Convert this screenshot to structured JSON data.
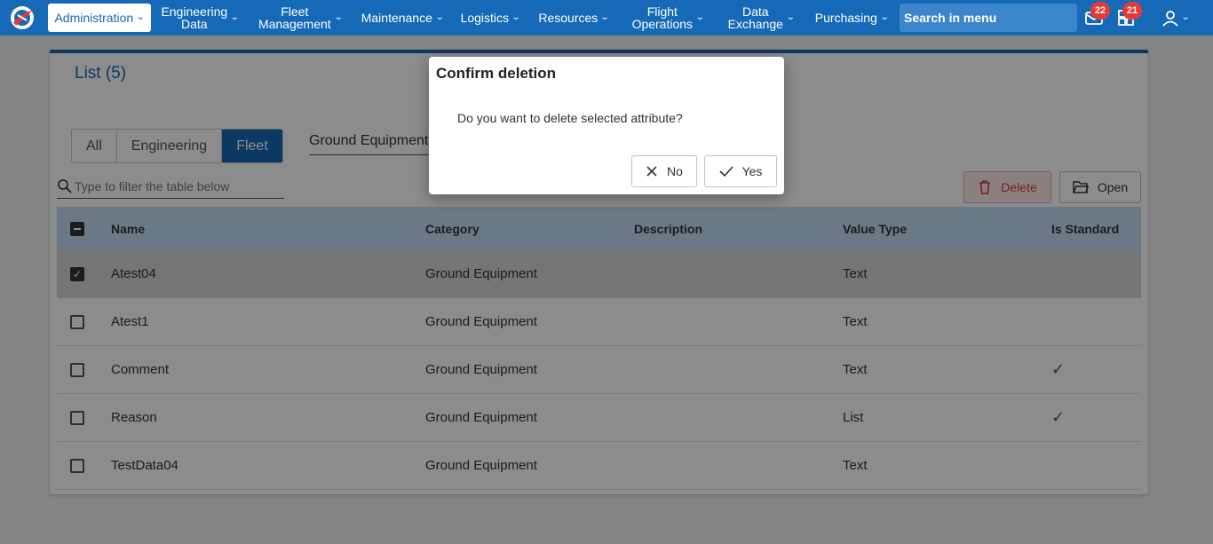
{
  "nav": {
    "items": [
      {
        "label": "Administration",
        "active": true
      },
      {
        "label": "Engineering\nData"
      },
      {
        "label": "Fleet\nManagement"
      },
      {
        "label": "Maintenance"
      },
      {
        "label": "Logistics"
      },
      {
        "label": "Resources"
      },
      {
        "label": "Flight\nOperations"
      },
      {
        "label": "Data\nExchange"
      },
      {
        "label": "Purchasing"
      }
    ],
    "search_label": "Search in menu",
    "mail_badge": "22",
    "dashboard_badge": "21"
  },
  "list": {
    "title": "List (5)",
    "tabs": [
      "All",
      "Engineering",
      "Fleet"
    ],
    "selected_tab": "Fleet",
    "category_select": "Ground Equipment",
    "filter_placeholder": "Type to filter the table below",
    "delete_label": "Delete",
    "open_label": "Open",
    "columns": [
      "Name",
      "Category",
      "Description",
      "Value Type",
      "Is Standard"
    ],
    "rows": [
      {
        "name": "Atest04",
        "category": "Ground Equipment",
        "description": "",
        "value_type": "Text",
        "is_standard": "",
        "selected": true
      },
      {
        "name": "Atest1",
        "category": "Ground Equipment",
        "description": "",
        "value_type": "Text",
        "is_standard": ""
      },
      {
        "name": "Comment",
        "category": "Ground Equipment",
        "description": "",
        "value_type": "Text",
        "is_standard": "✓"
      },
      {
        "name": "Reason",
        "category": "Ground Equipment",
        "description": "",
        "value_type": "List",
        "is_standard": "✓"
      },
      {
        "name": "TestData04",
        "category": "Ground Equipment",
        "description": "",
        "value_type": "Text",
        "is_standard": ""
      }
    ]
  },
  "dialog": {
    "title": "Confirm deletion",
    "message": "Do you want to delete selected attribute?",
    "no_label": "No",
    "yes_label": "Yes"
  },
  "colors": {
    "brand": "#1669b6",
    "header_row": "#c4dcf4",
    "danger": "#d73b3b",
    "badge": "#e53935"
  }
}
